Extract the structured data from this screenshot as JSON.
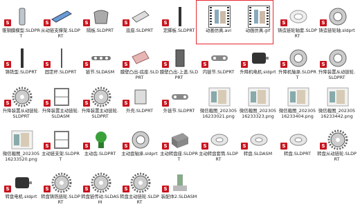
{
  "items": [
    {
      "label": "锥钢膜模型.SLDPRT",
      "icon": "cylinder-icon",
      "kind": "part"
    },
    {
      "label": "从动链支撑架.SLDPRT",
      "icon": "blue-bracket-icon",
      "kind": "part"
    },
    {
      "label": "隔板.SLDPRT",
      "icon": "curved-plate-icon",
      "kind": "part"
    },
    {
      "label": "底座.SLDPRT",
      "icon": "plate-icon",
      "kind": "part"
    },
    {
      "label": "定脚板.SLDPRT",
      "icon": "rod-icon",
      "kind": "part"
    },
    {
      "label": "动画仿真.avi",
      "icon": "video-icon",
      "kind": "video"
    },
    {
      "label": "动画仿真.gif",
      "icon": "video-icon",
      "kind": "video"
    },
    {
      "label": "铸造链轮轴套.SLDPRT",
      "icon": "sleeve-icon",
      "kind": "part"
    },
    {
      "label": "铸造链轮轴.sldprt",
      "icon": "bearing-icon",
      "kind": "part"
    },
    {
      "label": "铸铣型.SLDPRT",
      "icon": "rod-icon",
      "kind": "part"
    },
    {
      "label": "固定杆.SLDPRT",
      "icon": "long-rod-icon",
      "kind": "part"
    },
    {
      "label": "链节.SLDASM",
      "icon": "chain-icon",
      "kind": "asm"
    },
    {
      "label": "膜壁凸出-底座.SLDPRT",
      "icon": "pink-plate-icon",
      "kind": "part"
    },
    {
      "label": "膜壁凸出-上盖.SLDPRT",
      "icon": "dark-block-icon",
      "kind": "part"
    },
    {
      "label": "内链节.SLDPRT",
      "icon": "link-icon",
      "kind": "part"
    },
    {
      "label": "升降机电机.sldprt",
      "icon": "motor-icon",
      "kind": "part"
    },
    {
      "label": "升降机轴承.SLDPRT",
      "icon": "bearing-icon",
      "kind": "part"
    },
    {
      "label": "升降装置从动链轮.SLDPRT",
      "icon": "bearing-icon",
      "kind": "part"
    },
    {
      "label": "升降装置从动链轮.SLDPRT",
      "icon": "sprocket-icon",
      "kind": "part"
    },
    {
      "label": "升降装置主动链轮.SLDASM",
      "icon": "frame-icon",
      "kind": "asm"
    },
    {
      "label": "升降装置主动链轮.SLDPRT",
      "icon": "sprocket-icon",
      "kind": "part"
    },
    {
      "label": "外壳.SLDPRT",
      "icon": "box-frame-icon",
      "kind": "part"
    },
    {
      "label": "外链节.SLDPRT",
      "icon": "link-icon",
      "kind": "part"
    },
    {
      "label": "微信截图_20230516233021.png",
      "icon": "image-icon",
      "kind": "png"
    },
    {
      "label": "微信截图_20230516233323.png",
      "icon": "image-icon",
      "kind": "png"
    },
    {
      "label": "微信截图_20230516233404.png",
      "icon": "image-icon",
      "kind": "png"
    },
    {
      "label": "微信截图_20230516233442.png",
      "icon": "image-icon",
      "kind": "png"
    },
    {
      "label": "微信截图_20230516233520.png",
      "icon": "image-icon",
      "kind": "png"
    },
    {
      "label": "主动链支架.SLDPRT",
      "icon": "frame-icon",
      "kind": "part"
    },
    {
      "label": "主动齿.SLDPRT",
      "icon": "gear-green-icon",
      "kind": "part"
    },
    {
      "label": "主动盘轴承.sldprt",
      "icon": "bearing-icon",
      "kind": "part"
    },
    {
      "label": "主动转盘座.SLDPRT",
      "icon": "box-icon",
      "kind": "part"
    },
    {
      "label": "主动转盘套筒.SLDPRT",
      "icon": "ring-icon",
      "kind": "part"
    },
    {
      "label": "转盘.SLDASM",
      "icon": "ring-icon",
      "kind": "asm"
    },
    {
      "label": "转盘.SLDPRT",
      "icon": "ring-icon",
      "kind": "part"
    },
    {
      "label": "转盘从动链轮.SLDPRT",
      "icon": "sprocket-icon",
      "kind": "part"
    },
    {
      "label": "转盘电机.sldprt",
      "icon": "motor-icon",
      "kind": "part"
    },
    {
      "label": "转盘铸铣链轮.SLDPRT",
      "icon": "sprocket-icon",
      "kind": "part"
    },
    {
      "label": "转盘链传动.SLDASM",
      "icon": "sprocket-icon",
      "kind": "asm"
    },
    {
      "label": "转盘主动链轮.SLDPRT",
      "icon": "sprocket-icon",
      "kind": "part"
    },
    {
      "label": "装配体2.SLDASM",
      "icon": "assembly-icon",
      "kind": "asm"
    }
  ],
  "sw_badge": "S",
  "colors": {
    "selection": "#e8262f",
    "sw_red": "#c8141e"
  }
}
